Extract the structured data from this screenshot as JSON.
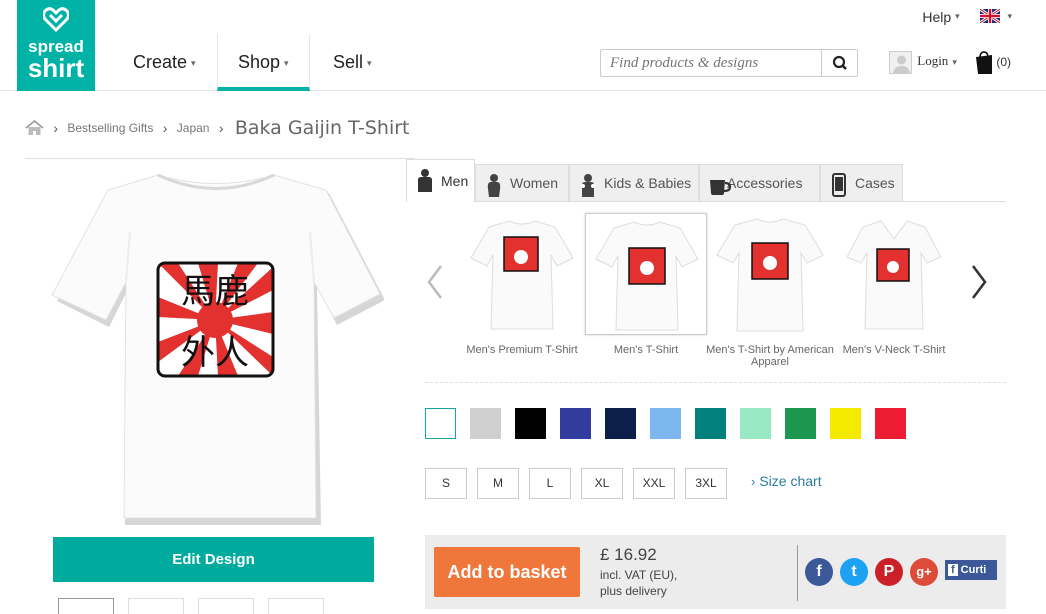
{
  "header": {
    "logo": {
      "line1": "spread",
      "line2": "shirt"
    },
    "nav": [
      {
        "label": "Create"
      },
      {
        "label": "Shop"
      },
      {
        "label": "Sell"
      }
    ],
    "help_label": "Help",
    "search": {
      "placeholder": "Find products & designs"
    },
    "login_label": "Login",
    "basket_count": "(0)"
  },
  "breadcrumb": {
    "items": [
      "Bestselling Gifts",
      "Japan"
    ],
    "title": "Baka Gaijin T-Shirt"
  },
  "design": {
    "line1": "馬鹿",
    "line2": "外人"
  },
  "edit_button": "Edit Design",
  "tabs": [
    {
      "label": "Men",
      "icon": "man-icon"
    },
    {
      "label": "Women",
      "icon": "woman-icon"
    },
    {
      "label": "Kids & Babies",
      "icon": "kids-icon"
    },
    {
      "label": "Accessories",
      "icon": "mug-icon"
    },
    {
      "label": "Cases",
      "icon": "phone-icon"
    }
  ],
  "product_types": [
    {
      "label": "Men's Premium T-Shirt"
    },
    {
      "label": "Men's T-Shirt"
    },
    {
      "label": "Men's T-Shirt by American Apparel"
    },
    {
      "label": "Men's V-Neck T-Shirt"
    }
  ],
  "colors": [
    "#ffffff",
    "#cfcfcf",
    "#000000",
    "#323c9f",
    "#0c1e4a",
    "#7cb7ef",
    "#00817b",
    "#99e8c4",
    "#1c9750",
    "#f4ea00",
    "#ee1c33"
  ],
  "sizes": [
    "S",
    "M",
    "L",
    "XL",
    "XXL",
    "3XL"
  ],
  "size_chart_label": "Size chart",
  "buy": {
    "add_label": "Add to basket",
    "price": "£ 16.92",
    "vat_line1": "incl. VAT (EU),",
    "vat_line2": "plus delivery"
  },
  "social": {
    "facebook": "f",
    "twitter": "t",
    "pinterest": "P",
    "google": "g+",
    "like_label": "Curti"
  },
  "accent_color": "#00b2a5"
}
